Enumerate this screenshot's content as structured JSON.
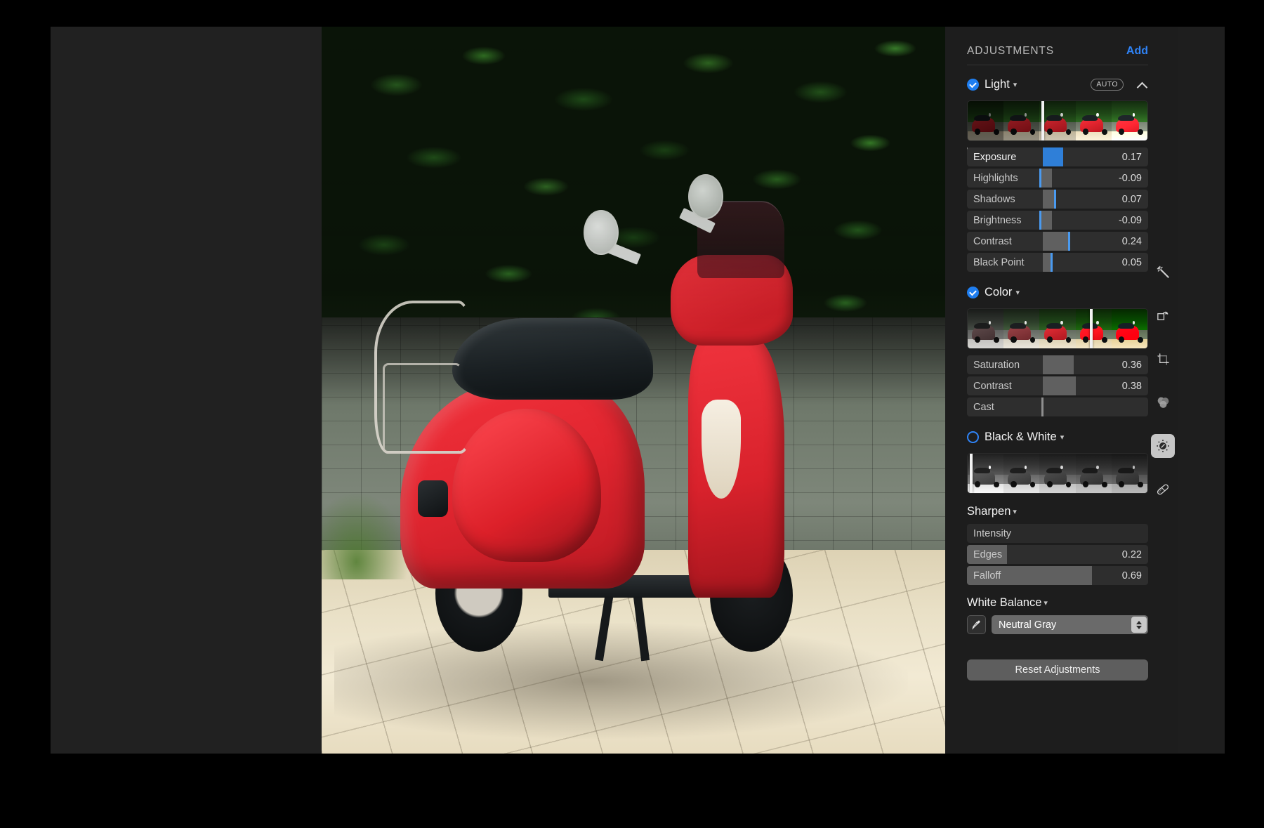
{
  "panel": {
    "title": "ADJUSTMENTS",
    "add_label": "Add",
    "reset_label": "Reset Adjustments"
  },
  "sections": {
    "light": {
      "name": "Light",
      "checked": true,
      "auto_label": "AUTO",
      "collapse_icon": "chevron-up-icon",
      "strip_marker_pct": 41,
      "sliders": [
        {
          "label": "Exposure",
          "value": "0.17",
          "type": "fill-blue",
          "fill_start_pct": 42,
          "fill_end_pct": 53,
          "ticks": true
        },
        {
          "label": "Highlights",
          "value": "-0.09",
          "type": "mark",
          "mark_pct": 40,
          "fill_start_pct": 40,
          "fill_end_pct": 47
        },
        {
          "label": "Shadows",
          "value": "0.07",
          "type": "mark",
          "mark_pct": 48,
          "fill_start_pct": 42,
          "fill_end_pct": 48
        },
        {
          "label": "Brightness",
          "value": "-0.09",
          "type": "mark",
          "mark_pct": 40,
          "fill_start_pct": 40,
          "fill_end_pct": 47
        },
        {
          "label": "Contrast",
          "value": "0.24",
          "type": "mark",
          "mark_pct": 56,
          "fill_start_pct": 42,
          "fill_end_pct": 56
        },
        {
          "label": "Black Point",
          "value": "0.05",
          "type": "mark",
          "mark_pct": 46,
          "fill_start_pct": 42,
          "fill_end_pct": 46
        }
      ]
    },
    "color": {
      "name": "Color",
      "checked": true,
      "strip_marker_pct": 68,
      "sliders": [
        {
          "label": "Saturation",
          "value": "0.36",
          "type": "fill",
          "fill_start_pct": 42,
          "fill_end_pct": 59
        },
        {
          "label": "Contrast",
          "value": "0.38",
          "type": "fill",
          "fill_start_pct": 42,
          "fill_end_pct": 60
        },
        {
          "label": "Cast",
          "value": "",
          "type": "mark-gray",
          "mark_pct": 41
        }
      ]
    },
    "black_and_white": {
      "name": "Black & White",
      "checked": false,
      "strip_marker_pct": 1
    },
    "sharpen": {
      "name": "Sharpen",
      "sliders": [
        {
          "label": "Intensity",
          "value": "",
          "type": "empty"
        },
        {
          "label": "Edges",
          "value": "0.22",
          "type": "fill",
          "fill_start_pct": 0,
          "fill_end_pct": 22
        },
        {
          "label": "Falloff",
          "value": "0.69",
          "type": "fill",
          "fill_start_pct": 0,
          "fill_end_pct": 69
        }
      ]
    },
    "white_balance": {
      "name": "White Balance",
      "eyedropper_icon": "eyedropper-icon",
      "mode": "Neutral Gray"
    }
  },
  "toolbar": {
    "items": [
      {
        "icon": "magic-wand-icon",
        "active": false
      },
      {
        "icon": "rotate-icon",
        "active": false
      },
      {
        "icon": "crop-icon",
        "active": false
      },
      {
        "icon": "filters-icon",
        "active": false
      },
      {
        "icon": "adjust-dial-icon",
        "active": true
      },
      {
        "icon": "retouch-icon",
        "active": false
      }
    ]
  },
  "colors": {
    "accent_blue": "#2f83f6",
    "slider_blue": "#2f7fd8",
    "panel_bg": "#1d1d1d",
    "canvas_bg": "#212121"
  },
  "photo": {
    "alt_name": "red-scooter-photo"
  }
}
